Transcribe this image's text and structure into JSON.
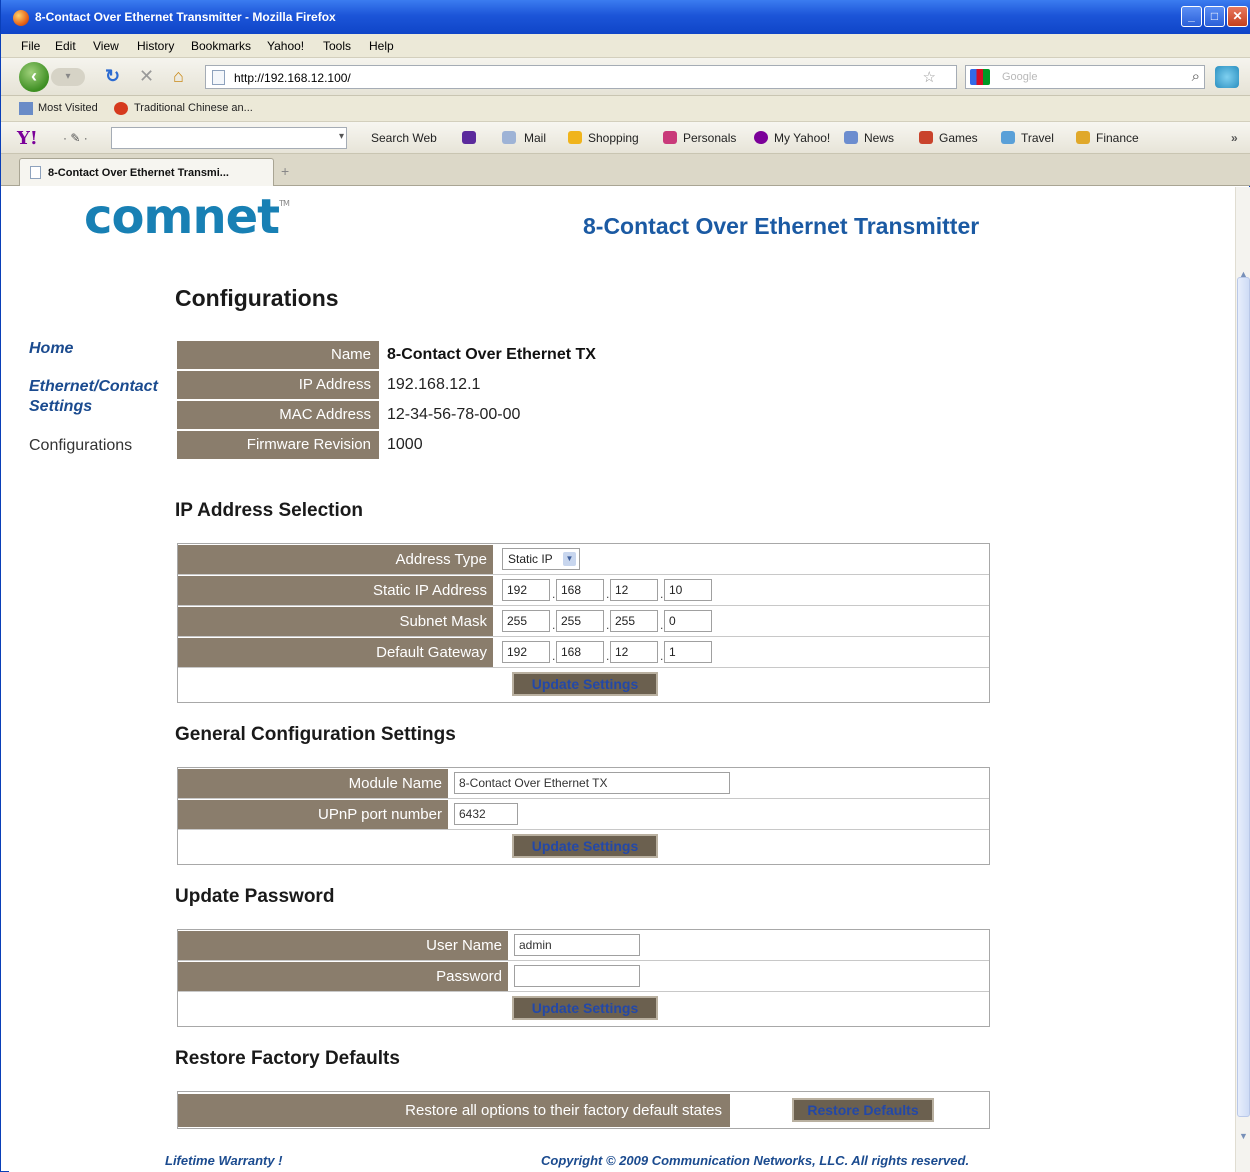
{
  "window": {
    "title": "8-Contact Over Ethernet Transmitter - Mozilla Firefox",
    "buttons": [
      "_",
      "□",
      "✕"
    ]
  },
  "menu": [
    "File",
    "Edit",
    "View",
    "History",
    "Bookmarks",
    "Yahoo!",
    "Tools",
    "Help"
  ],
  "nav": {
    "url": "http://192.168.12.100/",
    "search_placeholder": "Google"
  },
  "bookmarks": [
    "Most Visited",
    "Traditional Chinese an..."
  ],
  "yahoo_toolbar": [
    "Search Web",
    "Mail",
    "Shopping",
    "Personals",
    "My Yahoo!",
    "News",
    "Games",
    "Travel",
    "Finance"
  ],
  "tab": {
    "label": "8-Contact Over Ethernet Transmi..."
  },
  "page": {
    "logo": "comnet",
    "logo_tm": "TM",
    "heading": "8-Contact Over Ethernet Transmitter",
    "section_title": "Configurations"
  },
  "sidebar": {
    "items": [
      {
        "label": "Home"
      },
      {
        "label": "Ethernet/Contact Settings"
      },
      {
        "label": "Configurations"
      }
    ]
  },
  "device_info": [
    {
      "label": "Name",
      "value": "8-Contact Over Ethernet TX"
    },
    {
      "label": "IP Address",
      "value": "192.168.12.1"
    },
    {
      "label": "MAC Address",
      "value": "12-34-56-78-00-00"
    },
    {
      "label": "Firmware Revision",
      "value": "1000"
    }
  ],
  "ip_selection": {
    "title": "IP Address Selection",
    "address_type_label": "Address Type",
    "address_type_value": "Static IP",
    "static_ip_label": "Static IP Address",
    "static_ip": [
      "192",
      "168",
      "12",
      "10"
    ],
    "subnet_label": "Subnet Mask",
    "subnet": [
      "255",
      "255",
      "255",
      "0"
    ],
    "gateway_label": "Default Gateway",
    "gateway": [
      "192",
      "168",
      "12",
      "1"
    ],
    "button": "Update Settings"
  },
  "general": {
    "title": "General Configuration Settings",
    "module_label": "Module Name",
    "module_value": "8-Contact Over Ethernet TX",
    "upnp_label": "UPnP port number",
    "upnp_value": "6432",
    "button": "Update Settings"
  },
  "password": {
    "title": "Update Password",
    "user_label": "User Name",
    "user_value": "admin",
    "password_label": "Password",
    "password_value": "",
    "button": "Update Settings"
  },
  "restore": {
    "title": "Restore Factory Defaults",
    "label": "Restore all options to their factory default states",
    "button": "Restore Defaults"
  },
  "footer": {
    "left": "Lifetime Warranty !",
    "right": "Copyright © 2009 Communication Networks, LLC. All rights reserved."
  },
  "colors": {
    "label_bg": "#8a7d6c",
    "heading_blue": "#1b5aa3",
    "link_blue": "#1b4b8f",
    "logo_blue": "#1880b4",
    "button_bg": "#6b604f"
  }
}
